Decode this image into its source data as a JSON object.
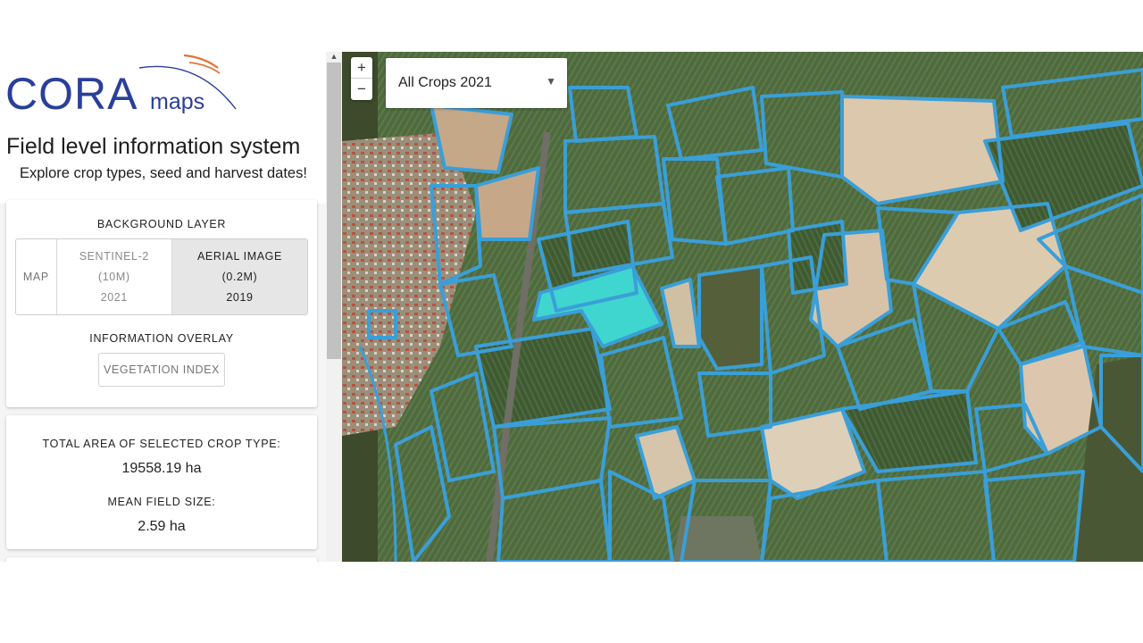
{
  "logo": {
    "main": "CORA",
    "sub": "maps"
  },
  "app": {
    "title": "Field level information system",
    "subtitle": "Explore crop types, seed and harvest dates!"
  },
  "layers": {
    "background_label": "BACKGROUND LAYER",
    "options": [
      {
        "line1": "MAP"
      },
      {
        "line1": "SENTINEL-2",
        "line2": "(10M)",
        "line3": "2021"
      },
      {
        "line1": "AERIAL IMAGE",
        "line2": "(0.2M)",
        "line3": "2019",
        "selected": true
      }
    ],
    "overlay_label": "INFORMATION OVERLAY",
    "overlay_button": "VEGETATION INDEX"
  },
  "stats": {
    "total_area_label": "TOTAL AREA OF SELECTED CROP TYPE:",
    "total_area_value": "19558.19 ha",
    "mean_size_label": "MEAN FIELD SIZE:",
    "mean_size_value": "2.59 ha"
  },
  "map": {
    "zoom_in": "+",
    "zoom_out": "−",
    "crop_select_value": "All Crops 2021",
    "field_outline_color": "#3a9fd8",
    "selected_field_color": "#3fd6cf"
  }
}
